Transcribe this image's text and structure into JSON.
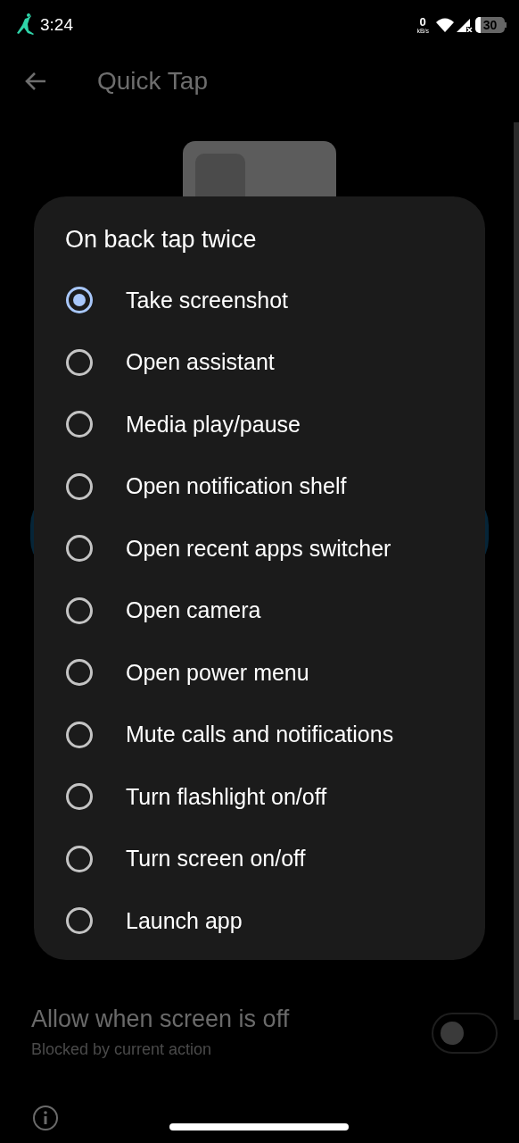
{
  "status_bar": {
    "time": "3:24",
    "net_speed": "0",
    "net_unit": "kB/s",
    "battery": "30"
  },
  "app_bar": {
    "title": "Quick Tap"
  },
  "dialog": {
    "title": "On back tap twice",
    "options": [
      {
        "label": "Take screenshot",
        "selected": true
      },
      {
        "label": "Open assistant",
        "selected": false
      },
      {
        "label": "Media play/pause",
        "selected": false
      },
      {
        "label": "Open notification shelf",
        "selected": false
      },
      {
        "label": "Open recent apps switcher",
        "selected": false
      },
      {
        "label": "Open camera",
        "selected": false
      },
      {
        "label": "Open power menu",
        "selected": false
      },
      {
        "label": "Mute calls and notifications",
        "selected": false
      },
      {
        "label": "Turn flashlight on/off",
        "selected": false
      },
      {
        "label": "Turn screen on/off",
        "selected": false
      },
      {
        "label": "Launch app",
        "selected": false
      }
    ]
  },
  "setting": {
    "title": "Allow when screen is off",
    "subtitle": "Blocked by current action",
    "on": false
  }
}
